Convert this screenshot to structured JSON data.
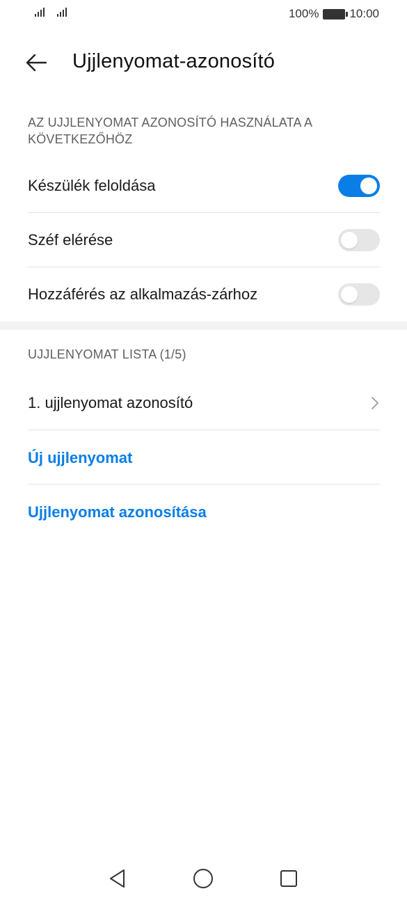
{
  "status_bar": {
    "battery_text": "100%",
    "time": "10:00",
    "icons": [
      "signal-icon",
      "signal-icon",
      "battery-icon"
    ]
  },
  "header": {
    "back_icon": "arrow-left-icon",
    "title": "Ujjlenyomat-azonosító"
  },
  "usage_section": {
    "header": "AZ UJJLENYOMAT AZONOSÍTÓ HASZNÁLATA A KÖVETKEZŐHÖZ",
    "items": [
      {
        "label": "Készülék feloldása",
        "enabled": true
      },
      {
        "label": "Széf elérése",
        "enabled": false
      },
      {
        "label": "Hozzáférés az alkalmazás-zárhoz",
        "enabled": false
      }
    ]
  },
  "list_section": {
    "header": "UJJLENYOMAT LISTA (1/5)",
    "fingerprints": [
      {
        "label": "1. ujjlenyomat azonosító",
        "icon": "chevron-right-icon"
      }
    ],
    "new_fingerprint": "Új ujjlenyomat",
    "identify_fingerprint": "Ujjlenyomat azonosítása"
  },
  "colors": {
    "accent": "#0a7ee6",
    "toggle_off": "#e6e6e6",
    "divider": "#e3e3e3",
    "section_header": "#5f5f5f"
  },
  "navbar": {
    "icons": [
      "back-triangle-icon",
      "home-circle-icon",
      "recents-square-icon"
    ]
  }
}
